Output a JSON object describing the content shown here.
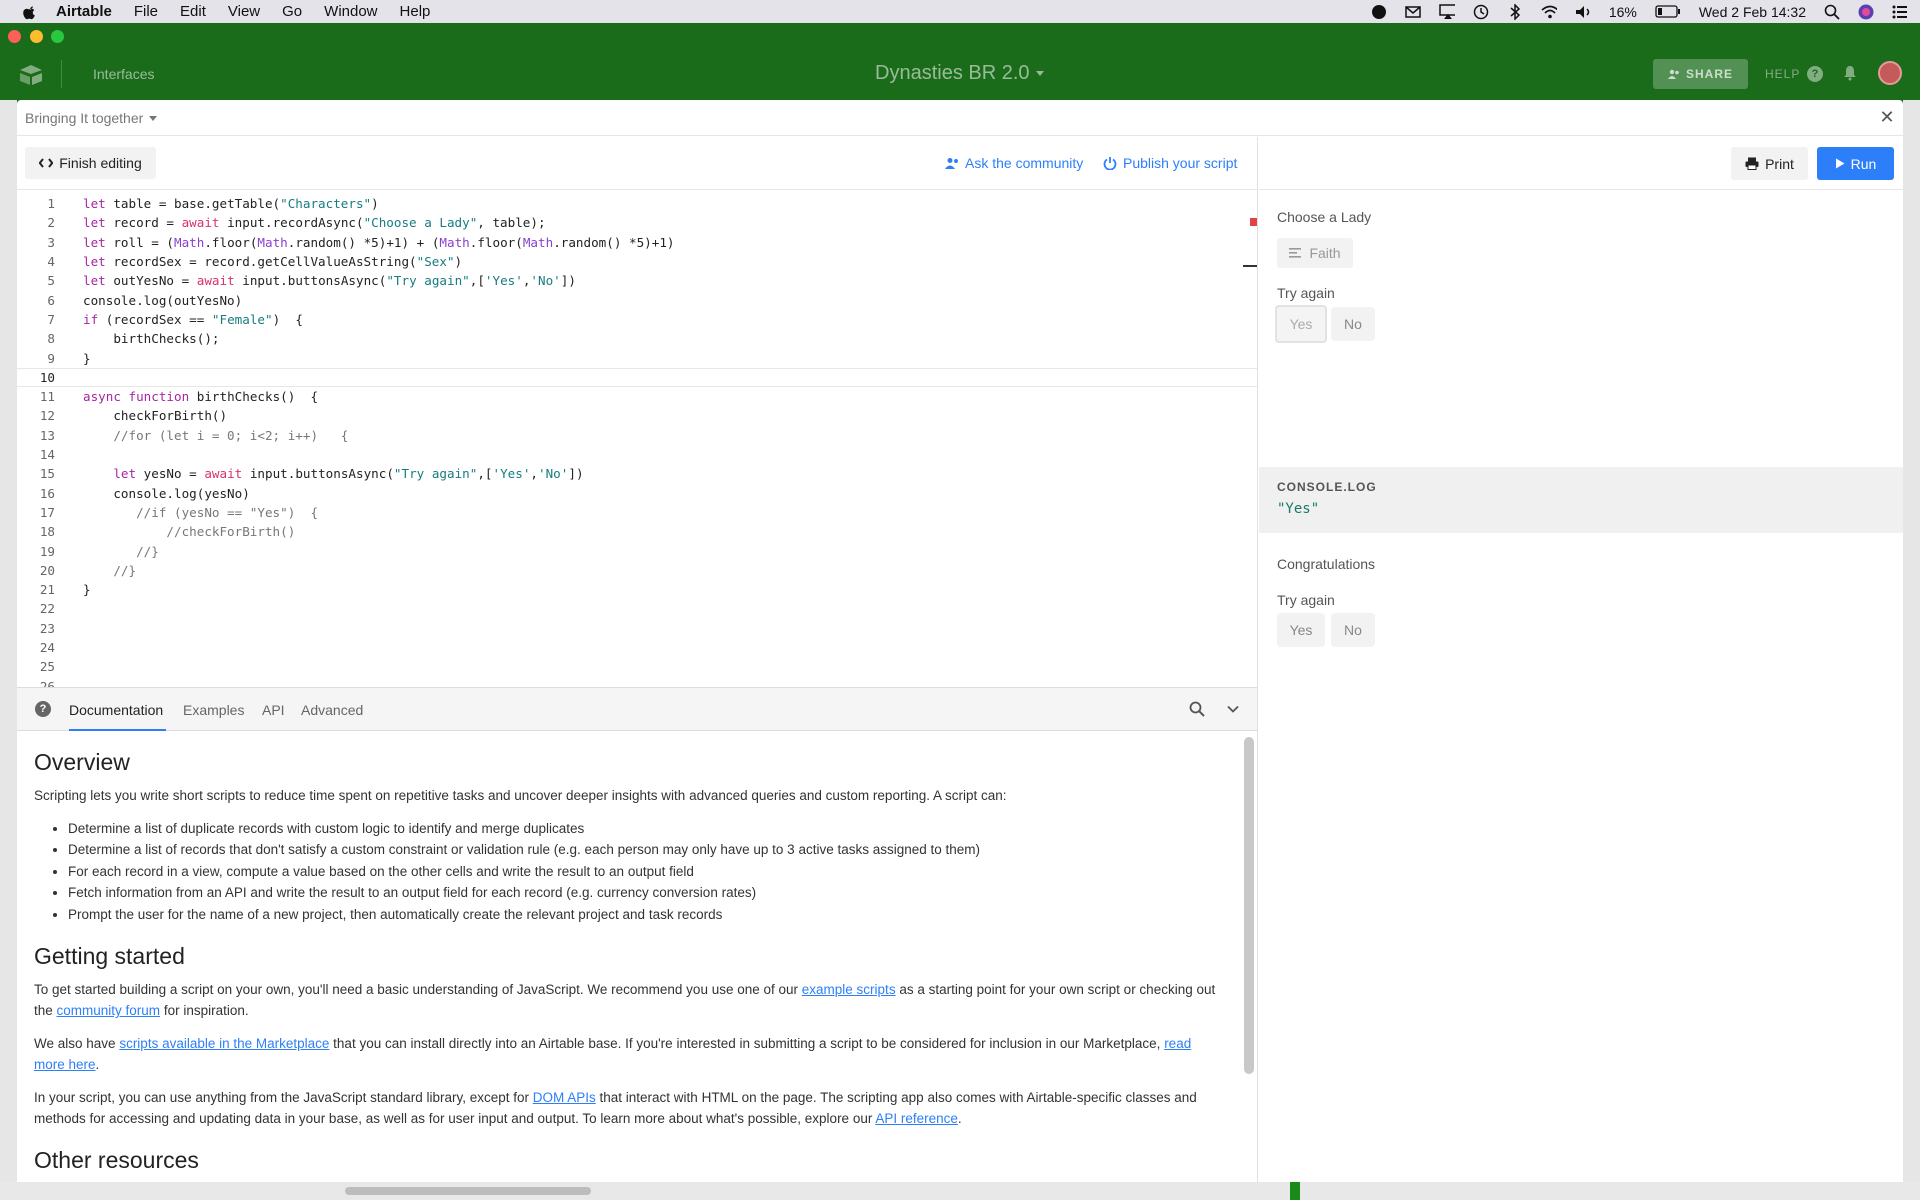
{
  "menubar": {
    "app_name": "Airtable",
    "items": [
      "File",
      "Edit",
      "View",
      "Go",
      "Window",
      "Help"
    ],
    "battery": "16%",
    "datetime": "Wed 2 Feb  14:32"
  },
  "header": {
    "interfaces": "Interfaces",
    "base_name": "Dynasties BR 2.0",
    "share": "SHARE",
    "help": "HELP",
    "brand_color": "#1a6b1a"
  },
  "modal": {
    "title": "Bringing It together"
  },
  "editor": {
    "finish_editing": "Finish editing",
    "ask_community": "Ask the community",
    "publish_script": "Publish your script",
    "active_line": 10,
    "code_lines": [
      "let table = base.getTable(\"Characters\")",
      "let record = await input.recordAsync(\"Choose a Lady\", table);",
      "let roll = (Math.floor(Math.random() *5)+1) + (Math.floor(Math.random() *5)+1)",
      "let recordSex = record.getCellValueAsString(\"Sex\")",
      "let outYesNo = await input.buttonsAsync(\"Try again\",['Yes','No'])",
      "console.log(outYesNo)",
      "if (recordSex == \"Female\")  {",
      "    birthChecks();",
      "}",
      "",
      "async function birthChecks()  {",
      "    checkForBirth()",
      "    //for (let i = 0; i<2; i++)   {",
      "",
      "    let yesNo = await input.buttonsAsync(\"Try again\",['Yes','No'])",
      "    console.log(yesNo)",
      "       //if (yesNo == \"Yes\")  {",
      "           //checkForBirth()",
      "       //}",
      "    //}",
      "}",
      "",
      "",
      "",
      "",
      ""
    ]
  },
  "docs": {
    "tabs": [
      "Documentation",
      "Examples",
      "API",
      "Advanced"
    ],
    "active_tab": "Documentation",
    "overview_title": "Overview",
    "overview_intro": "Scripting lets you write short scripts to reduce time spent on repetitive tasks and uncover deeper insights with advanced queries and custom reporting. A script can:",
    "bullets": [
      "Determine a list of duplicate records with custom logic to identify and merge duplicates",
      "Determine a list of records that don't satisfy a custom constraint or validation rule (e.g. each person may only have up to 3 active tasks assigned to them)",
      "For each record in a view, compute a value based on the other cells and write the result to an output field",
      "Fetch information from an API and write the result to an output field for each record (e.g. currency conversion rates)",
      "Prompt the user for the name of a new project, then automatically create the relevant project and task records"
    ],
    "getting_started_title": "Getting started",
    "gs_p1_a": "To get started building a script on your own, you'll need a basic understanding of JavaScript. We recommend you use one of our ",
    "gs_p1_link1": "example scripts",
    "gs_p1_b": " as a starting point for your own script or checking out the ",
    "gs_p1_link2": "community forum",
    "gs_p1_c": " for inspiration.",
    "gs_p2_a": "We also have ",
    "gs_p2_link1": "scripts available in the Marketplace",
    "gs_p2_b": " that you can install directly into an Airtable base. If you're interested in submitting a script to be considered for inclusion in our Marketplace, ",
    "gs_p2_link2": "read more here",
    "gs_p2_c": ".",
    "gs_p3_a": "In your script, you can use anything from the JavaScript standard library, except for ",
    "gs_p3_link1": "DOM APIs",
    "gs_p3_b": " that interact with HTML on the page. The scripting app also comes with Airtable-specific classes and methods for accessing and updating data in your base, as well as for user input and output. To learn more about what's possible, explore our ",
    "gs_p3_link2": "API reference",
    "gs_p3_c": ".",
    "other_resources_title": "Other resources"
  },
  "output": {
    "print": "Print",
    "run": "Run",
    "choose_label": "Choose a Lady",
    "chosen_record": "Faith",
    "try_again_1": "Try again",
    "yes_1": "Yes",
    "no_1": "No",
    "console_label": "CONSOLE.LOG",
    "console_value": "\"Yes\"",
    "congrats": "Congratulations",
    "try_again_2": "Try again",
    "yes_2": "Yes",
    "no_2": "No",
    "run_color": "#2d7ff9"
  }
}
